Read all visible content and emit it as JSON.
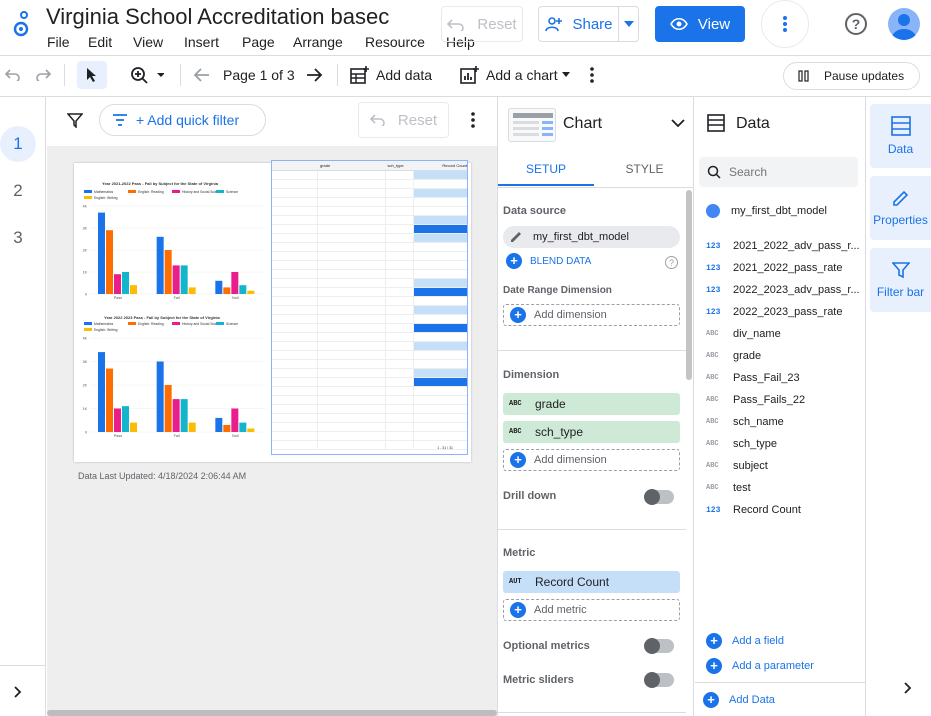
{
  "app": {
    "title": "Virginia School Accreditation basec"
  },
  "menu": [
    "File",
    "Edit",
    "View",
    "Insert",
    "Page",
    "Arrange",
    "Resource",
    "Help"
  ],
  "header": {
    "reset": "Reset",
    "share": "Share",
    "view": "View"
  },
  "toolbar": {
    "page_indicator": "Page 1 of 3",
    "add_data": "Add data",
    "add_chart": "Add a chart",
    "pause": "Pause updates"
  },
  "pages": [
    "1",
    "2",
    "3"
  ],
  "filterbar": {
    "add_quick_filter": "+ Add quick filter",
    "reset": "Reset"
  },
  "report": {
    "chart1_title": "Year 2021-2022 Pass - Fail by Subject for the State of Virginia",
    "chart2_title": "Year 2022 2023 Pass - Fail by Subject for the State of Virginia",
    "legend": [
      "Mathematics",
      "English: Reading",
      "History and Social Scie...",
      "Science",
      "English: Writing"
    ],
    "categories": [
      "Pass",
      "Fail",
      "Null"
    ],
    "yticks1": [
      "4K",
      "3K",
      "2K",
      "1K",
      "0"
    ],
    "yticks2": [
      "4K",
      "3K",
      "2K",
      "1K",
      "0"
    ],
    "table_headers": [
      "grade",
      "sch_type",
      "Record Count"
    ],
    "table_footer": "1 - 31 / 31",
    "data_updated": "Data Last Updated: 4/18/2024 2:06:44 AM"
  },
  "chart_data": [
    {
      "type": "bar",
      "title": "Year 2021-2022 Pass - Fail by Subject for the State of Virginia",
      "categories": [
        "Pass",
        "Fail",
        "Null"
      ],
      "ylim": [
        0,
        4000
      ],
      "series": [
        {
          "name": "Mathematics",
          "values": [
            3700,
            2600,
            600
          ]
        },
        {
          "name": "English: Reading",
          "values": [
            2900,
            2000,
            300
          ]
        },
        {
          "name": "History and Social Scie...",
          "values": [
            900,
            1300,
            1000
          ]
        },
        {
          "name": "Science",
          "values": [
            1000,
            1300,
            400
          ]
        },
        {
          "name": "English: Writing",
          "values": [
            400,
            300,
            150
          ]
        }
      ]
    },
    {
      "type": "bar",
      "title": "Year 2022 2023 Pass - Fail by Subject for the State of Virginia",
      "categories": [
        "Pass",
        "Fail",
        "Null"
      ],
      "ylim": [
        0,
        4000
      ],
      "series": [
        {
          "name": "Mathematics",
          "values": [
            3400,
            3000,
            600
          ]
        },
        {
          "name": "English: Reading",
          "values": [
            2700,
            2000,
            300
          ]
        },
        {
          "name": "History and Social Scie...",
          "values": [
            1000,
            1400,
            1000
          ]
        },
        {
          "name": "Science",
          "values": [
            1100,
            1400,
            400
          ]
        },
        {
          "name": "English: Writing",
          "values": [
            400,
            400,
            150
          ]
        }
      ]
    }
  ],
  "setup": {
    "panel_title": "Chart",
    "tab_setup": "SETUP",
    "tab_style": "STYLE",
    "data_source_label": "Data source",
    "data_source": "my_first_dbt_model",
    "blend": "BLEND DATA",
    "date_range_label": "Date Range Dimension",
    "add_dimension": "Add dimension",
    "dimension_label": "Dimension",
    "dimensions": [
      {
        "type": "ABC",
        "name": "grade"
      },
      {
        "type": "ABC",
        "name": "sch_type"
      }
    ],
    "drill_down": "Drill down",
    "metric_label": "Metric",
    "metrics": [
      {
        "type": "AUT",
        "name": "Record Count"
      }
    ],
    "add_metric": "Add metric",
    "optional_metrics": "Optional metrics",
    "metric_sliders": "Metric sliders"
  },
  "datapanel": {
    "title": "Data",
    "search_placeholder": "Search",
    "source": "my_first_dbt_model",
    "fields": [
      {
        "type": "123",
        "name": "2021_2022_adv_pass_r..."
      },
      {
        "type": "123",
        "name": "2021_2022_pass_rate"
      },
      {
        "type": "123",
        "name": "2022_2023_adv_pass_r..."
      },
      {
        "type": "123",
        "name": "2022_2023_pass_rate"
      },
      {
        "type": "ABC",
        "name": "div_name"
      },
      {
        "type": "ABC",
        "name": "grade"
      },
      {
        "type": "ABC",
        "name": "Pass_Fail_23"
      },
      {
        "type": "ABC",
        "name": "Pass_Fails_22"
      },
      {
        "type": "ABC",
        "name": "sch_name"
      },
      {
        "type": "ABC",
        "name": "sch_type"
      },
      {
        "type": "ABC",
        "name": "subject"
      },
      {
        "type": "ABC",
        "name": "test"
      },
      {
        "type": "123",
        "name": "Record Count"
      }
    ],
    "add_field": "Add a field",
    "add_parameter": "Add a parameter",
    "add_data": "Add Data"
  },
  "righttabs": {
    "data": "Data",
    "properties": "Properties",
    "filter_bar": "Filter bar"
  },
  "colors": {
    "accent": "#1a73e8",
    "series": [
      "#1a73e8",
      "#ff6d00",
      "#e91e8c",
      "#12b5cb",
      "#fbbc04"
    ]
  }
}
